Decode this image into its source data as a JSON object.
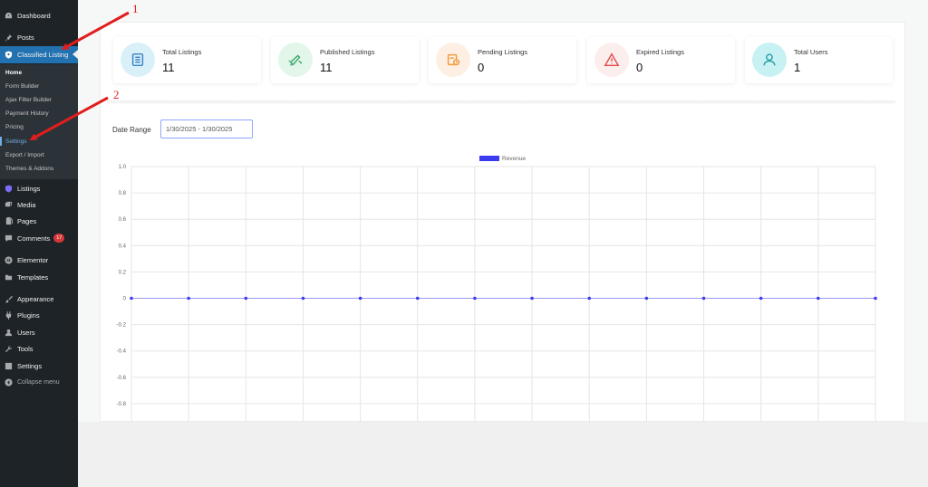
{
  "sidebar": {
    "top_items": [
      {
        "label": "Dashboard",
        "icon": "dashboard-icon"
      },
      {
        "label": "Posts",
        "icon": "pin-icon"
      },
      {
        "label": "Classified Listing",
        "icon": "classified-listing-icon"
      }
    ],
    "submenu": [
      {
        "label": "Home"
      },
      {
        "label": "Form Builder"
      },
      {
        "label": "Ajax Filter Builder"
      },
      {
        "label": "Payment History"
      },
      {
        "label": "Pricing"
      },
      {
        "label": "Settings"
      },
      {
        "label": "Export / Import"
      },
      {
        "label": "Themes & Addons"
      }
    ],
    "items": [
      {
        "label": "Listings",
        "icon": "listings-icon"
      },
      {
        "label": "Media",
        "icon": "media-icon"
      },
      {
        "label": "Pages",
        "icon": "pages-icon"
      },
      {
        "label": "Comments",
        "icon": "comments-icon",
        "badge": "17"
      },
      {
        "label": "Elementor",
        "icon": "elementor-icon"
      },
      {
        "label": "Templates",
        "icon": "folder-icon"
      },
      {
        "label": "Appearance",
        "icon": "brush-icon"
      },
      {
        "label": "Plugins",
        "icon": "plugin-icon"
      },
      {
        "label": "Users",
        "icon": "users-icon"
      },
      {
        "label": "Tools",
        "icon": "wrench-icon"
      },
      {
        "label": "Settings",
        "icon": "settings-icon"
      },
      {
        "label": "Collapse menu",
        "icon": "collapse-icon"
      }
    ]
  },
  "stats": [
    {
      "label": "Total Listings",
      "value": "11",
      "icon": "list-icon",
      "color": "#3b82c4",
      "bg": "#d9f0f9"
    },
    {
      "label": "Published Listings",
      "value": "11",
      "icon": "megaphone-icon",
      "color": "#3aa76d",
      "bg": "#e3f6ea"
    },
    {
      "label": "Pending Listings",
      "value": "0",
      "icon": "clock-doc-icon",
      "color": "#f09a3e",
      "bg": "#fdf0e3"
    },
    {
      "label": "Expired Listings",
      "value": "0",
      "icon": "warning-icon",
      "color": "#e04b4b",
      "bg": "#fdeeee"
    },
    {
      "label": "Total Users",
      "value": "1",
      "icon": "user-icon",
      "color": "#2b9fa8",
      "bg": "#c8f1f3"
    }
  ],
  "filters": {
    "date_range_label": "Date Range",
    "date_range_value": "1/30/2025 - 1/30/2025"
  },
  "annotations": {
    "marker_1": "1",
    "marker_2": "2",
    "arrow_color": "#e11d1d"
  },
  "chart_data": {
    "type": "line",
    "title": "",
    "xlabel": "",
    "ylabel": "",
    "x_tick_labels": [],
    "series": [
      {
        "name": "Revenue",
        "color": "#3b3bf0",
        "values": [
          0,
          0,
          0,
          0,
          0,
          0,
          0,
          0,
          0,
          0,
          0,
          0,
          0,
          0
        ]
      }
    ],
    "ylim": [
      -0.8,
      1.0
    ],
    "y_ticks": [
      "1.0",
      "0.8",
      "0.6",
      "0.4",
      "0.2",
      "0",
      "-0.2",
      "-0.4",
      "-0.6",
      "-0.8"
    ],
    "grid": true,
    "legend": "top-center"
  }
}
